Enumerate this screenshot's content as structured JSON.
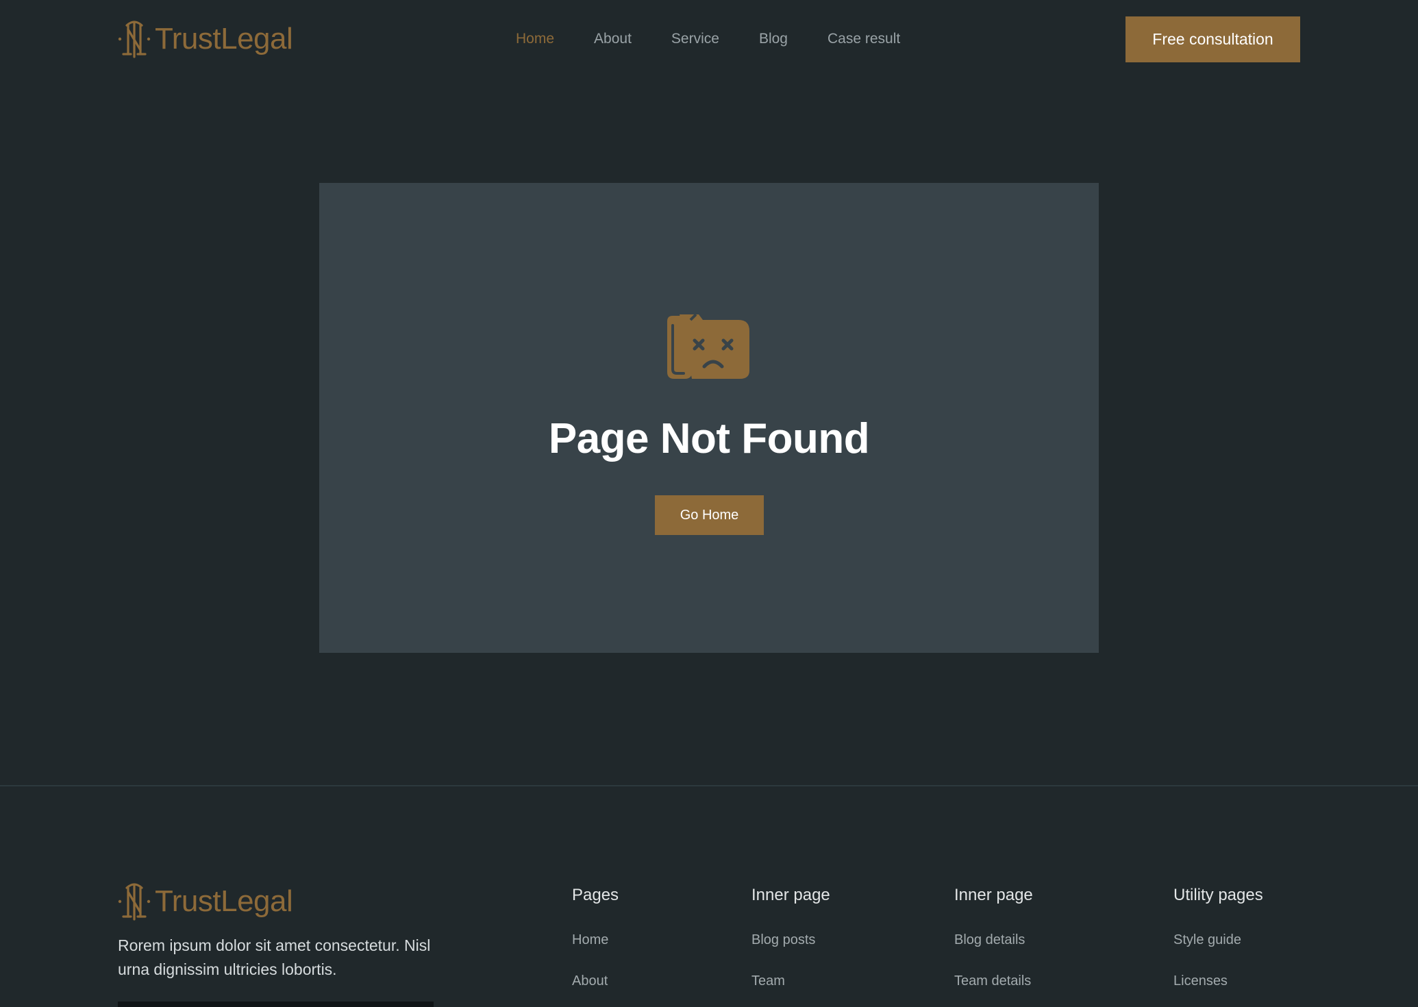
{
  "header": {
    "logo_text": "TrustLegal",
    "nav": [
      {
        "label": "Home",
        "active": true
      },
      {
        "label": "About",
        "active": false
      },
      {
        "label": "Service",
        "active": false
      },
      {
        "label": "Blog",
        "active": false
      },
      {
        "label": "Case result",
        "active": false
      }
    ],
    "cta_label": "Free consultation"
  },
  "main": {
    "icon": "sad-folder-icon",
    "title": "Page Not Found",
    "button_label": "Go Home"
  },
  "footer": {
    "logo_text": "TrustLegal",
    "description": "Rorem ipsum dolor sit amet consectetur. Nisl urna dignissim ultricies lobortis.",
    "columns": [
      {
        "title": "Pages",
        "links": [
          "Home",
          "About"
        ]
      },
      {
        "title": "Inner page",
        "links": [
          "Blog posts",
          "Team"
        ]
      },
      {
        "title": "Inner page",
        "links": [
          "Blog details",
          "Team details"
        ]
      },
      {
        "title": "Utility pages",
        "links": [
          "Style guide",
          "Licenses"
        ]
      }
    ]
  },
  "colors": {
    "background": "#20282b",
    "card": "#384349",
    "accent": "#8d6a39",
    "nav_text": "#9aa3a7"
  }
}
